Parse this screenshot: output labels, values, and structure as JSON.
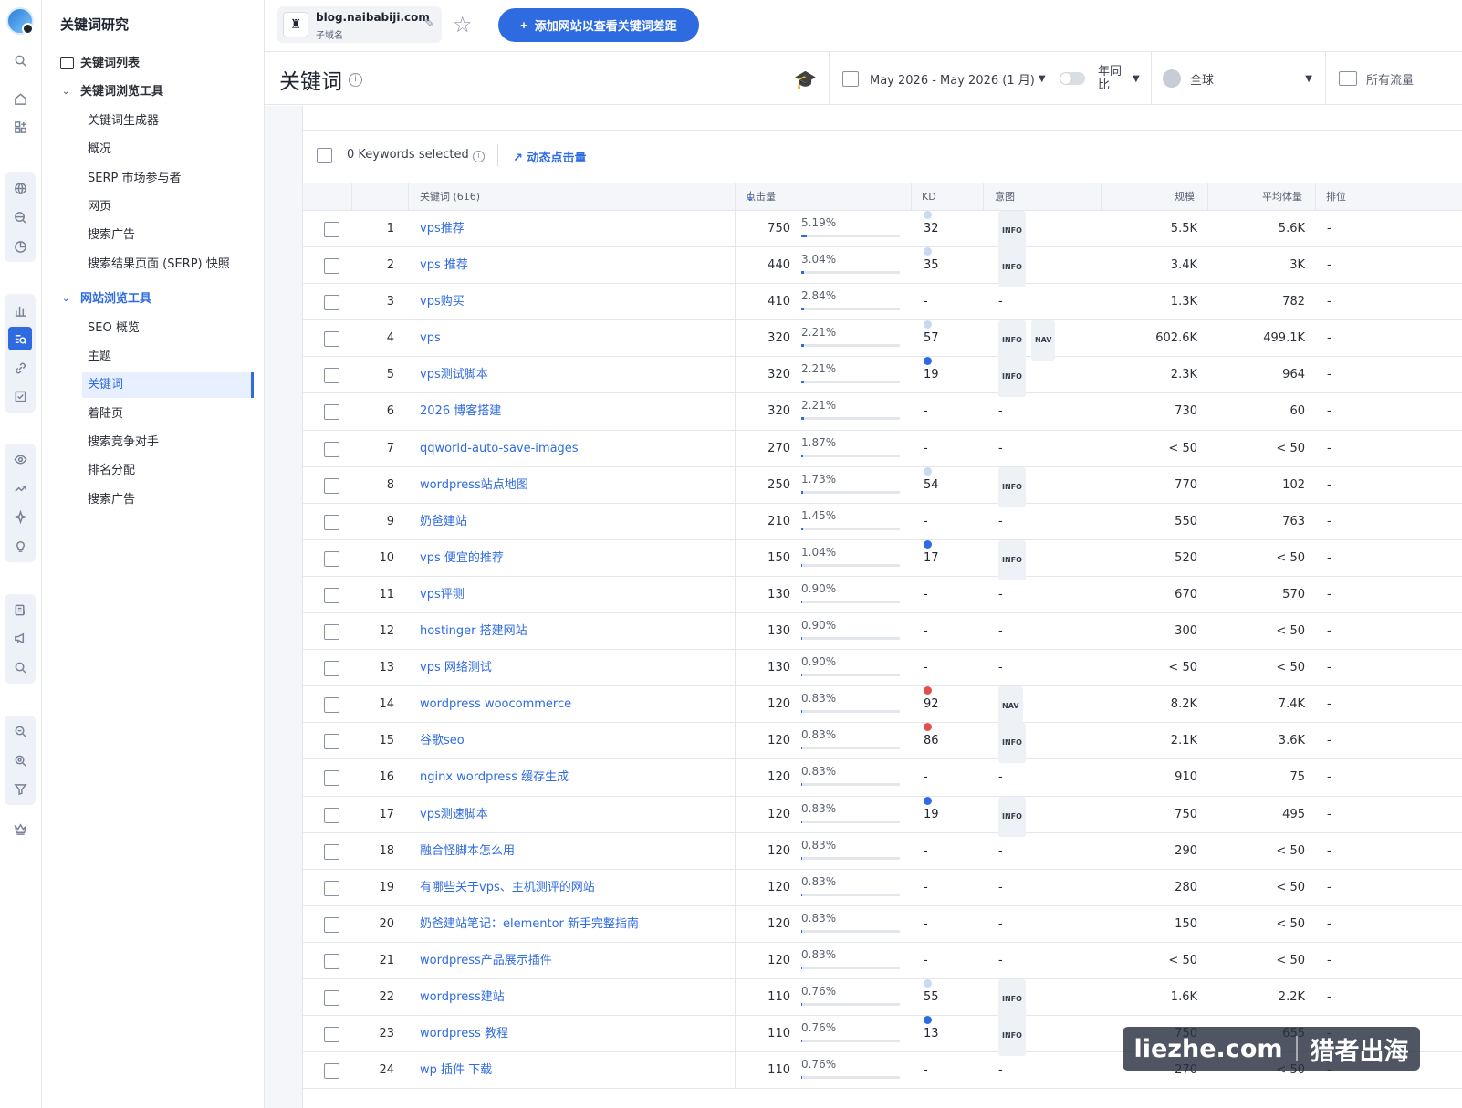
{
  "sidebar": {
    "title": "关键词研究",
    "keyword_list": "关键词列表",
    "kw_tools": "关键词浏览工具",
    "kw_items": [
      "关键词生成器",
      "概况",
      "SERP 市场参与者",
      "网页",
      "搜索广告",
      "搜索结果页面 (SERP) 快照"
    ],
    "site_tools": "网站浏览工具",
    "site_items": [
      "SEO 概览",
      "主题",
      "关键词",
      "着陆页",
      "搜索竞争对手",
      "排名分配",
      "搜索广告"
    ],
    "active_item": "关键词"
  },
  "topbar": {
    "domain": "blog.naibabiji.com",
    "domain_sub": "子域名",
    "add_button": "添加网站以查看关键词差距"
  },
  "header": {
    "title": "关键词",
    "date_range": "May 2026 - May 2026 (1 月)",
    "yoy": "年同比",
    "region": "全球",
    "traffic": "所有流量"
  },
  "toolbar": {
    "selected": "0 Keywords selected",
    "dynamic": "动态点击量"
  },
  "table": {
    "columns": {
      "keyword": "关键词 (616)",
      "clicks": "点击量",
      "kd": "KD",
      "intent": "意图",
      "volume": "规模",
      "avg_volume": "平均体量",
      "position": "排位"
    },
    "rows": [
      {
        "n": "1",
        "kw": "vps推荐",
        "clicks": "750",
        "pct": "5.19%",
        "share": 5.19,
        "kd": "32",
        "kdc": "#c9d9f3",
        "intent": [
          "INFO"
        ],
        "vol": "5.5K",
        "avg": "5.6K",
        "pos": "-"
      },
      {
        "n": "2",
        "kw": "vps 推荐",
        "clicks": "440",
        "pct": "3.04%",
        "share": 3.04,
        "kd": "35",
        "kdc": "#c9d9f3",
        "intent": [
          "INFO"
        ],
        "vol": "3.4K",
        "avg": "3K",
        "pos": "-"
      },
      {
        "n": "3",
        "kw": "vps购买",
        "clicks": "410",
        "pct": "2.84%",
        "share": 2.84,
        "kd": "-",
        "kdc": "",
        "intent": [
          "-"
        ],
        "vol": "1.3K",
        "avg": "782",
        "pos": "-"
      },
      {
        "n": "4",
        "kw": "vps",
        "clicks": "320",
        "pct": "2.21%",
        "share": 2.21,
        "kd": "57",
        "kdc": "#c9d9f3",
        "intent": [
          "INFO",
          "NAV"
        ],
        "vol": "602.6K",
        "avg": "499.1K",
        "pos": "-"
      },
      {
        "n": "5",
        "kw": "vps测试脚本",
        "clicks": "320",
        "pct": "2.21%",
        "share": 2.21,
        "kd": "19",
        "kdc": "#2f6be0",
        "intent": [
          "INFO"
        ],
        "vol": "2.3K",
        "avg": "964",
        "pos": "-"
      },
      {
        "n": "6",
        "kw": "2026 博客搭建",
        "clicks": "320",
        "pct": "2.21%",
        "share": 2.21,
        "kd": "-",
        "kdc": "",
        "intent": [
          "-"
        ],
        "vol": "730",
        "avg": "60",
        "pos": "-"
      },
      {
        "n": "7",
        "kw": "qqworld-auto-save-images",
        "clicks": "270",
        "pct": "1.87%",
        "share": 1.87,
        "kd": "-",
        "kdc": "",
        "intent": [
          "-"
        ],
        "vol": "< 50",
        "avg": "< 50",
        "pos": "-"
      },
      {
        "n": "8",
        "kw": "wordpress站点地图",
        "clicks": "250",
        "pct": "1.73%",
        "share": 1.73,
        "kd": "54",
        "kdc": "#c9d9f3",
        "intent": [
          "INFO"
        ],
        "vol": "770",
        "avg": "102",
        "pos": "-"
      },
      {
        "n": "9",
        "kw": "奶爸建站",
        "clicks": "210",
        "pct": "1.45%",
        "share": 1.45,
        "kd": "-",
        "kdc": "",
        "intent": [
          "-"
        ],
        "vol": "550",
        "avg": "763",
        "pos": "-"
      },
      {
        "n": "10",
        "kw": "vps 便宜的推荐",
        "clicks": "150",
        "pct": "1.04%",
        "share": 1.04,
        "kd": "17",
        "kdc": "#2f6be0",
        "intent": [
          "INFO"
        ],
        "vol": "520",
        "avg": "< 50",
        "pos": "-"
      },
      {
        "n": "11",
        "kw": "vps评测",
        "clicks": "130",
        "pct": "0.90%",
        "share": 0.9,
        "kd": "-",
        "kdc": "",
        "intent": [
          "-"
        ],
        "vol": "670",
        "avg": "570",
        "pos": "-"
      },
      {
        "n": "12",
        "kw": "hostinger 搭建网站",
        "clicks": "130",
        "pct": "0.90%",
        "share": 0.9,
        "kd": "-",
        "kdc": "",
        "intent": [
          "-"
        ],
        "vol": "300",
        "avg": "< 50",
        "pos": "-"
      },
      {
        "n": "13",
        "kw": "vps 网络测试",
        "clicks": "130",
        "pct": "0.90%",
        "share": 0.9,
        "kd": "-",
        "kdc": "",
        "intent": [
          "-"
        ],
        "vol": "< 50",
        "avg": "< 50",
        "pos": "-"
      },
      {
        "n": "14",
        "kw": "wordpress woocommerce",
        "clicks": "120",
        "pct": "0.83%",
        "share": 0.83,
        "kd": "92",
        "kdc": "#e0504e",
        "intent": [
          "NAV"
        ],
        "vol": "8.2K",
        "avg": "7.4K",
        "pos": "-"
      },
      {
        "n": "15",
        "kw": "谷歌seo",
        "clicks": "120",
        "pct": "0.83%",
        "share": 0.83,
        "kd": "86",
        "kdc": "#e0504e",
        "intent": [
          "INFO"
        ],
        "vol": "2.1K",
        "avg": "3.6K",
        "pos": "-"
      },
      {
        "n": "16",
        "kw": "nginx wordpress 缓存生成",
        "clicks": "120",
        "pct": "0.83%",
        "share": 0.83,
        "kd": "-",
        "kdc": "",
        "intent": [
          "-"
        ],
        "vol": "910",
        "avg": "75",
        "pos": "-"
      },
      {
        "n": "17",
        "kw": "vps测速脚本",
        "clicks": "120",
        "pct": "0.83%",
        "share": 0.83,
        "kd": "19",
        "kdc": "#2f6be0",
        "intent": [
          "INFO"
        ],
        "vol": "750",
        "avg": "495",
        "pos": "-"
      },
      {
        "n": "18",
        "kw": "融合怪脚本怎么用",
        "clicks": "120",
        "pct": "0.83%",
        "share": 0.83,
        "kd": "-",
        "kdc": "",
        "intent": [
          "-"
        ],
        "vol": "290",
        "avg": "< 50",
        "pos": "-"
      },
      {
        "n": "19",
        "kw": "有哪些关于vps、主机测评的网站",
        "clicks": "120",
        "pct": "0.83%",
        "share": 0.83,
        "kd": "-",
        "kdc": "",
        "intent": [
          "-"
        ],
        "vol": "280",
        "avg": "< 50",
        "pos": "-"
      },
      {
        "n": "20",
        "kw": "奶爸建站笔记：elementor 新手完整指南",
        "clicks": "120",
        "pct": "0.83%",
        "share": 0.83,
        "kd": "-",
        "kdc": "",
        "intent": [
          "-"
        ],
        "vol": "150",
        "avg": "< 50",
        "pos": "-"
      },
      {
        "n": "21",
        "kw": "wordpress产品展示插件",
        "clicks": "120",
        "pct": "0.83%",
        "share": 0.83,
        "kd": "-",
        "kdc": "",
        "intent": [
          "-"
        ],
        "vol": "< 50",
        "avg": "< 50",
        "pos": "-"
      },
      {
        "n": "22",
        "kw": "wordpress建站",
        "clicks": "110",
        "pct": "0.76%",
        "share": 0.76,
        "kd": "55",
        "kdc": "#c9d9f3",
        "intent": [
          "INFO"
        ],
        "vol": "1.6K",
        "avg": "2.2K",
        "pos": "-"
      },
      {
        "n": "23",
        "kw": "wordpress 教程",
        "clicks": "110",
        "pct": "0.76%",
        "share": 0.76,
        "kd": "13",
        "kdc": "#2f6be0",
        "intent": [
          "INFO"
        ],
        "vol": "750",
        "avg": "655",
        "pos": "-"
      },
      {
        "n": "24",
        "kw": "wp 插件 下载",
        "clicks": "110",
        "pct": "0.76%",
        "share": 0.76,
        "kd": "-",
        "kdc": "",
        "intent": [
          "-"
        ],
        "vol": "270",
        "avg": "< 50",
        "pos": "-"
      }
    ]
  },
  "watermark": {
    "left": "liezhe.com",
    "right": "猎者出海"
  }
}
